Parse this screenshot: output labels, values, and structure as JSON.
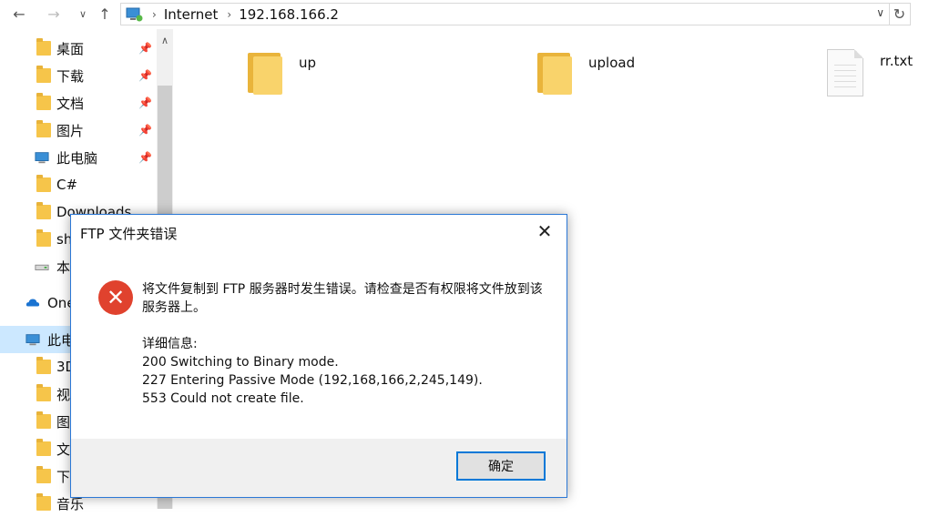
{
  "address_bar": {
    "crumbs": [
      "Internet",
      "192.168.166.2"
    ]
  },
  "sidebar": {
    "items": [
      {
        "label": "桌面",
        "icon": "desktop-folder-icon",
        "pinned": true
      },
      {
        "label": "下载",
        "icon": "downloads-folder-icon",
        "pinned": true
      },
      {
        "label": "文档",
        "icon": "documents-folder-icon",
        "pinned": true
      },
      {
        "label": "图片",
        "icon": "pictures-folder-icon",
        "pinned": true
      },
      {
        "label": "此电脑",
        "icon": "computer-icon",
        "pinned": true
      },
      {
        "label": "C#",
        "icon": "folder-icon",
        "pinned": false
      },
      {
        "label": "Downloads",
        "icon": "folder-icon",
        "pinned": false
      },
      {
        "label": "sh",
        "icon": "folder-icon",
        "pinned": false
      },
      {
        "label": "本",
        "icon": "drive-icon",
        "pinned": false
      },
      {
        "label": "One",
        "icon": "onedrive-icon",
        "pinned": false
      },
      {
        "label": "此电",
        "icon": "computer-icon",
        "pinned": false,
        "selected": true
      },
      {
        "label": "3D",
        "icon": "3d-objects-folder-icon",
        "pinned": false
      },
      {
        "label": "视",
        "icon": "videos-folder-icon",
        "pinned": false
      },
      {
        "label": "图",
        "icon": "pictures-folder-icon",
        "pinned": false
      },
      {
        "label": "文",
        "icon": "documents-folder-icon",
        "pinned": false
      },
      {
        "label": "下",
        "icon": "downloads-folder-icon",
        "pinned": false
      },
      {
        "label": "音乐",
        "icon": "music-folder-icon",
        "pinned": false
      }
    ]
  },
  "files": [
    {
      "name": "up",
      "type": "folder"
    },
    {
      "name": "upload",
      "type": "folder"
    },
    {
      "name": "rr.txt",
      "type": "text-file"
    }
  ],
  "dialog": {
    "title": "FTP 文件夹错误",
    "message": "将文件复制到 FTP 服务器时发生错误。请检查是否有权限将文件放到该服务器上。",
    "details_heading": "详细信息:",
    "details": [
      "200 Switching to Binary mode.",
      "227 Entering Passive Mode (192,168,166,2,245,149).",
      "553 Could not create file."
    ],
    "ok_label": "确定",
    "icon": "error-icon",
    "accent_color": "#0078d7",
    "error_color": "#e0422e"
  }
}
